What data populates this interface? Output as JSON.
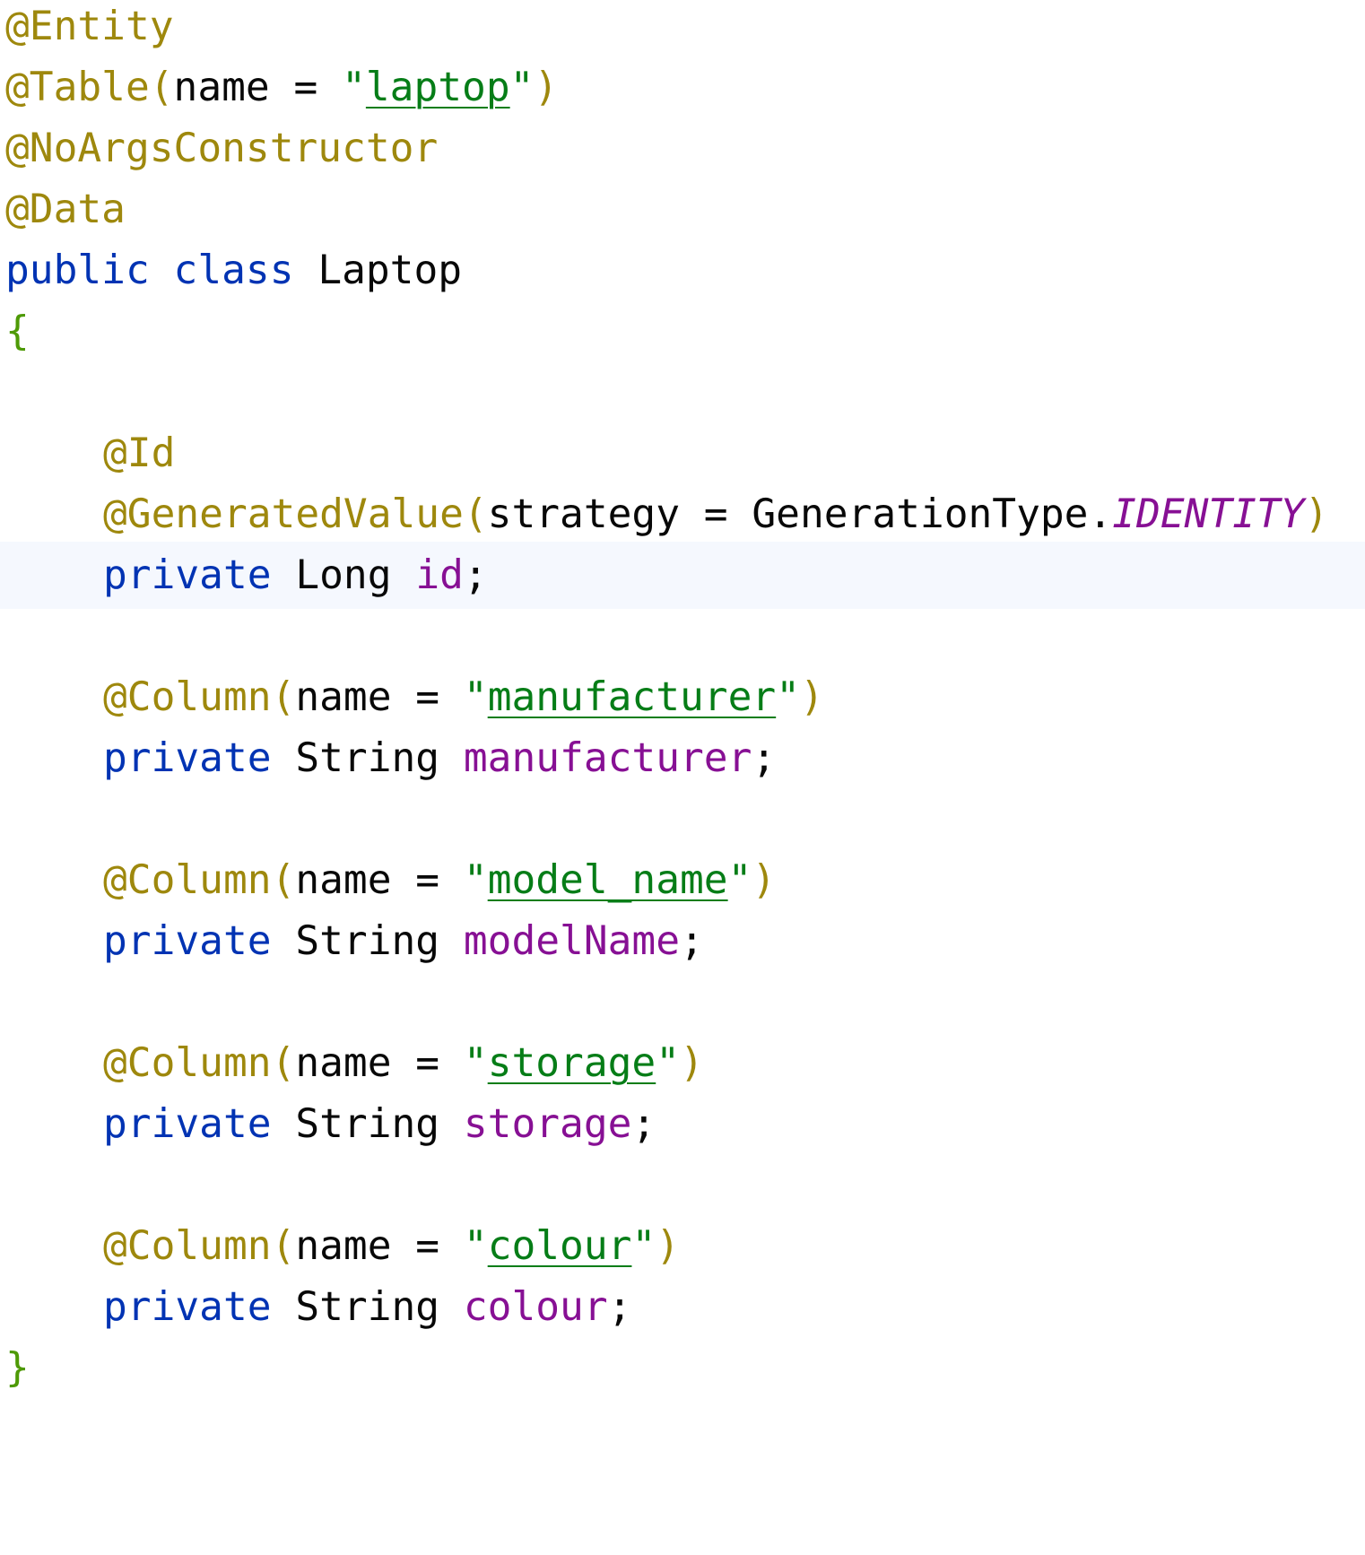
{
  "editor": {
    "lines": [
      {
        "ann": "@Entity"
      },
      {
        "ann": "@Table",
        "paren_open": "(",
        "arg": "name = ",
        "q1": "\"",
        "str": "laptop",
        "q2": "\"",
        "paren_close": ")"
      },
      {
        "ann": "@NoArgsConstructor"
      },
      {
        "ann": "@Data"
      },
      {
        "kw1": "public",
        "kw2": "class",
        "name": "Laptop"
      },
      {
        "brace": "{"
      },
      {},
      {
        "ann": "@Id"
      },
      {
        "ann": "@GeneratedValue",
        "paren_open": "(",
        "arg": "strategy = GenerationType.",
        "const": "IDENTITY",
        "paren_close": ")"
      },
      {
        "kw": "private",
        "type": "Long",
        "field": "id",
        "semi": ";"
      },
      {},
      {
        "ann": "@Column",
        "paren_open": "(",
        "arg": "name = ",
        "q1": "\"",
        "str": "manufacturer",
        "q2": "\"",
        "paren_close": ")"
      },
      {
        "kw": "private",
        "type": "String",
        "field": "manufacturer",
        "semi": ";"
      },
      {},
      {
        "ann": "@Column",
        "paren_open": "(",
        "arg": "name = ",
        "q1": "\"",
        "str": "model_name",
        "q2": "\"",
        "paren_close": ")"
      },
      {
        "kw": "private",
        "type": "String",
        "field": "modelName",
        "semi": ";"
      },
      {},
      {
        "ann": "@Column",
        "paren_open": "(",
        "arg": "name = ",
        "q1": "\"",
        "str": "storage",
        "q2": "\"",
        "paren_close": ")"
      },
      {
        "kw": "private",
        "type": "String",
        "field": "storage",
        "semi": ";"
      },
      {},
      {
        "ann": "@Column",
        "paren_open": "(",
        "arg": "name = ",
        "q1": "\"",
        "str": "colour",
        "q2": "\"",
        "paren_close": ")"
      },
      {
        "kw": "private",
        "type": "String",
        "field": "colour",
        "semi": ";"
      },
      {
        "brace": "}"
      }
    ],
    "highlighted_line": 10
  },
  "colors": {
    "background": "#ffffff",
    "current_line": "#f5f8fe",
    "annotation": "#9e880d",
    "keyword": "#0033b3",
    "string": "#067d17",
    "field": "#871094",
    "brace": "#4e9a06",
    "text": "#080808"
  }
}
